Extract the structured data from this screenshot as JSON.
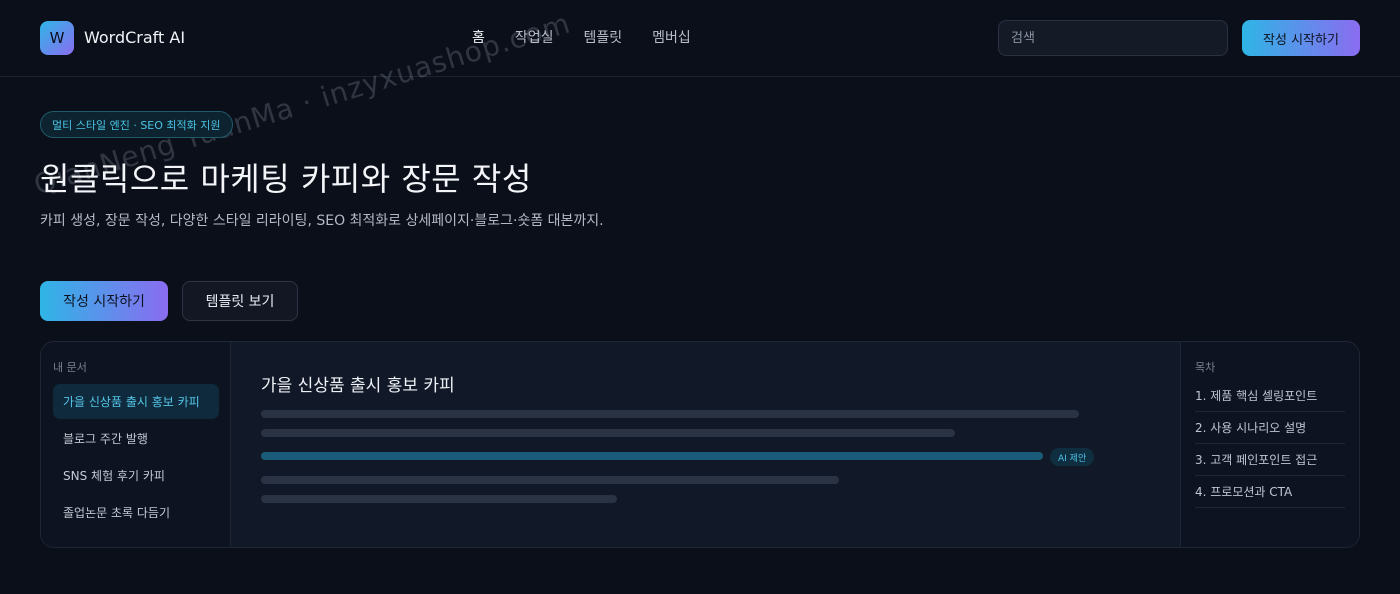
{
  "header": {
    "logo_letter": "W",
    "app_name": "WordCraft AI",
    "nav": [
      "홈",
      "작업실",
      "템플릿",
      "멤버십"
    ],
    "search_placeholder": "검색",
    "cta_label": "작성 시작하기"
  },
  "watermark": "QianNeng YuanMa · inzyxuashop.com",
  "hero": {
    "badge": "멀티 스타일 엔진 · SEO 최적화 지원",
    "title": "원클릭으로 마케팅 카피와 장문 작성",
    "description": "카피 생성, 장문 작성, 다양한 스타일 리라이팅, SEO 최적화로 상세페이지·블로그·숏폼 대본까지.",
    "primary_button": "작성 시작하기",
    "secondary_button": "템플릿 보기"
  },
  "sidebar": {
    "heading": "내 문서",
    "documents": [
      "가을 신상품 출시 홍보 카피",
      "블로그 주간 발행",
      "SNS 체험 후기 카피",
      "졸업논문 초록 다듬기"
    ]
  },
  "editor": {
    "title": "가을 신상품 출시 홍보 카피",
    "ai_chip": "AI 제안"
  },
  "toc": {
    "heading": "목차",
    "items": [
      "1. 제품 핵심 셀링포인트",
      "2. 사용 시나리오 설명",
      "3. 고객 페인포인트 접근",
      "4. 프로모션과 CTA"
    ]
  },
  "colors": {
    "background": "#0b0f1a",
    "accent_start": "#2fb5e6",
    "accent_end": "#8a6cf0",
    "highlight": "#55c6e8"
  }
}
